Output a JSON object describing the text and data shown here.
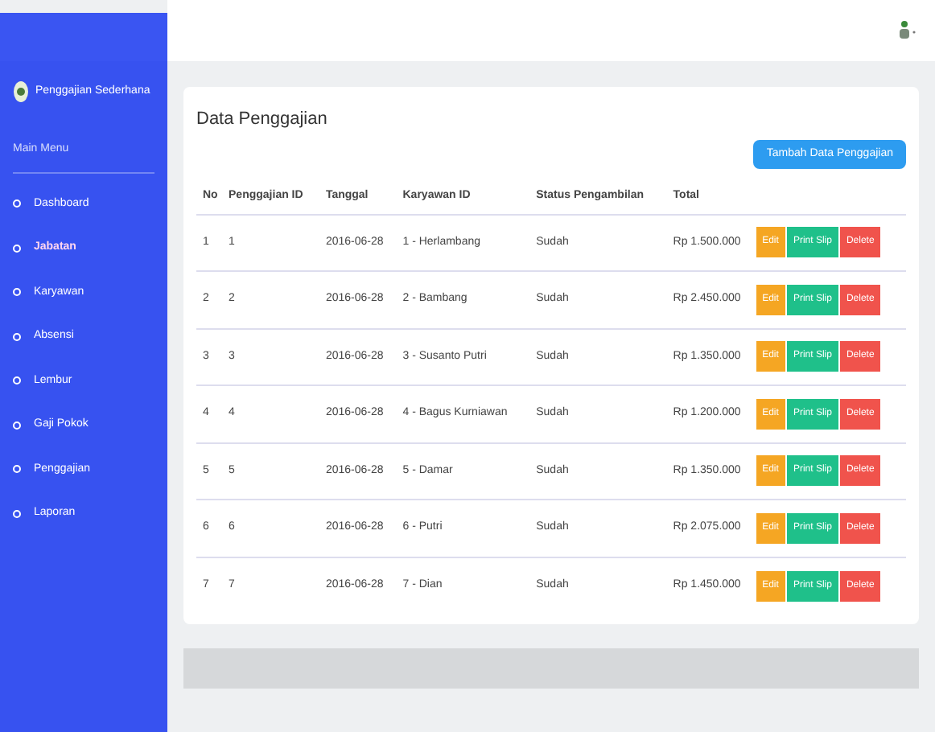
{
  "sidebar": {
    "brand": "Penggajian Sederhana",
    "section": "Main Menu",
    "items": [
      {
        "label": "Dashboard",
        "selected": false
      },
      {
        "label": "Jabatan",
        "selected": true
      },
      {
        "label": "Karyawan",
        "selected": false
      },
      {
        "label": "Absensi",
        "selected": false
      },
      {
        "label": "Lembur",
        "selected": false
      },
      {
        "label": "Gaji Pokok",
        "selected": false
      },
      {
        "label": "Penggajian",
        "selected": false
      },
      {
        "label": "Laporan",
        "selected": false
      }
    ]
  },
  "page": {
    "title": "Data Penggajian",
    "add_button": "Tambah Data Penggajian"
  },
  "table": {
    "columns": [
      "No",
      "Penggajian ID",
      "Tanggal",
      "Karyawan ID",
      "Status Pengambilan",
      "Total"
    ],
    "rows": [
      {
        "cells": [
          "1",
          "1",
          "2016-06-28",
          "1 - Herlambang",
          "Sudah",
          "Rp 1.500.000"
        ],
        "actions": [
          "Edit",
          "Print Slip",
          "Delete"
        ]
      },
      {
        "cells": [
          "2",
          "2",
          "2016-06-28",
          "2 - Bambang",
          "Sudah",
          "Rp 2.450.000"
        ],
        "actions": [
          "Edit",
          "Print Slip",
          "Delete"
        ]
      },
      {
        "cells": [
          "3",
          "3",
          "2016-06-28",
          "3 - Susanto Putri",
          "Sudah",
          "Rp 1.350.000"
        ],
        "actions": [
          "Edit",
          "Print Slip",
          "Delete"
        ]
      },
      {
        "cells": [
          "4",
          "4",
          "2016-06-28",
          "4 - Bagus Kurniawan",
          "Sudah",
          "Rp 1.200.000"
        ],
        "actions": [
          "Edit",
          "Print Slip",
          "Delete"
        ]
      },
      {
        "cells": [
          "5",
          "5",
          "2016-06-28",
          "5 - Damar",
          "Sudah",
          "Rp 1.350.000"
        ],
        "actions": [
          "Edit",
          "Print Slip",
          "Delete"
        ]
      },
      {
        "cells": [
          "6",
          "6",
          "2016-06-28",
          "6 - Putri",
          "Sudah",
          "Rp 2.075.000"
        ],
        "actions": [
          "Edit",
          "Print Slip",
          "Delete"
        ]
      },
      {
        "cells": [
          "7",
          "7",
          "2016-06-28",
          "7 - Dian",
          "Sudah",
          "Rp 1.450.000"
        ],
        "actions": [
          "Edit",
          "Print Slip",
          "Delete"
        ]
      }
    ]
  }
}
